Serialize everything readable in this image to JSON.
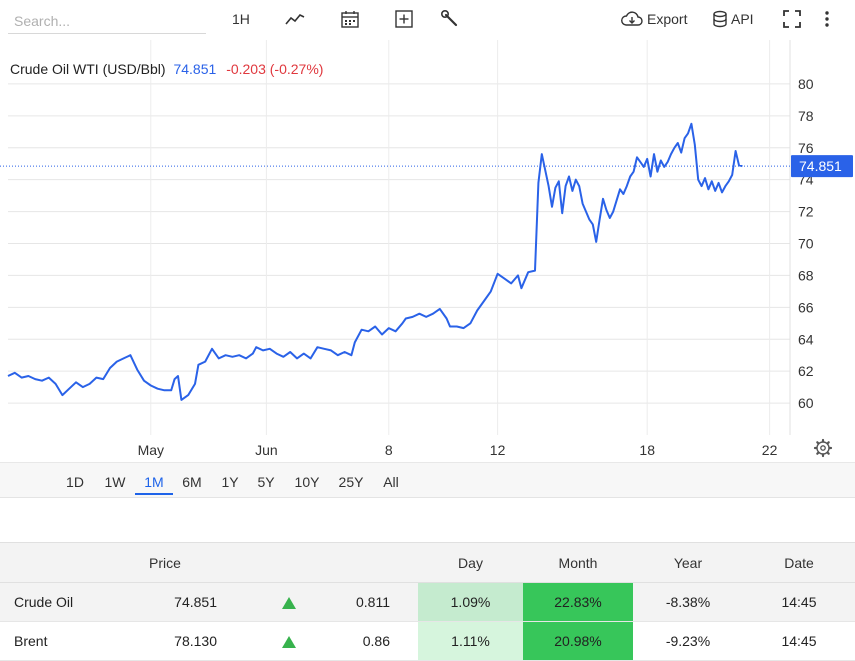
{
  "toolbar": {
    "search_placeholder": "Search...",
    "interval_label": "1H",
    "export_label": "Export",
    "api_label": "API",
    "icons": [
      "line-chart-icon",
      "calendar-icon",
      "plus-square-icon",
      "wrench-icon",
      "cloud-download-icon",
      "database-icon",
      "fullscreen-icon",
      "more-vertical-icon"
    ]
  },
  "quote": {
    "name": "Crude Oil WTI (USD/Bbl)",
    "price": "74.851",
    "change": "-0.203 (-0.27%)",
    "price_label": "74.851"
  },
  "colors": {
    "line": "#2a62e8",
    "negative": "#e0383e",
    "price_tag": "#2a62e8",
    "day_cell_1": "#c5ebcf",
    "day_cell_2": "#d6f5dd",
    "month_cell": "#37c65a"
  },
  "chart_data": {
    "type": "line",
    "series": [
      {
        "name": "Crude Oil WTI (USD/Bbl)",
        "values": [
          [
            0,
            61.7
          ],
          [
            2,
            61.9
          ],
          [
            4,
            61.6
          ],
          [
            6,
            61.7
          ],
          [
            8,
            61.5
          ],
          [
            10,
            61.4
          ],
          [
            12,
            61.6
          ],
          [
            14,
            61.2
          ],
          [
            16,
            60.5
          ],
          [
            18,
            60.9
          ],
          [
            20,
            61.3
          ],
          [
            22,
            61.0
          ],
          [
            24,
            61.2
          ],
          [
            26,
            61.6
          ],
          [
            28,
            61.5
          ],
          [
            30,
            62.2
          ],
          [
            32,
            62.6
          ],
          [
            34,
            62.8
          ],
          [
            36,
            63.0
          ],
          [
            38,
            62.1
          ],
          [
            40,
            61.4
          ],
          [
            42,
            61.1
          ],
          [
            44,
            60.9
          ],
          [
            46,
            60.8
          ],
          [
            48,
            60.8
          ],
          [
            49,
            61.5
          ],
          [
            50,
            61.7
          ],
          [
            51,
            60.2
          ],
          [
            53,
            60.5
          ],
          [
            55,
            61.2
          ],
          [
            56,
            62.4
          ],
          [
            58,
            62.6
          ],
          [
            60,
            63.4
          ],
          [
            62,
            62.8
          ],
          [
            64,
            63.0
          ],
          [
            66,
            62.9
          ],
          [
            68,
            63.0
          ],
          [
            70,
            62.8
          ],
          [
            72,
            63.1
          ],
          [
            73,
            63.5
          ],
          [
            75,
            63.3
          ],
          [
            77,
            63.4
          ],
          [
            79,
            63.1
          ],
          [
            81,
            62.9
          ],
          [
            83,
            63.2
          ],
          [
            85,
            62.8
          ],
          [
            87,
            63.1
          ],
          [
            89,
            62.8
          ],
          [
            91,
            63.5
          ],
          [
            93,
            63.4
          ],
          [
            95,
            63.3
          ],
          [
            97,
            63.0
          ],
          [
            99,
            63.2
          ],
          [
            101,
            63.0
          ],
          [
            102,
            63.8
          ],
          [
            104,
            64.6
          ],
          [
            106,
            64.5
          ],
          [
            108,
            64.8
          ],
          [
            110,
            64.3
          ],
          [
            112,
            64.7
          ],
          [
            114,
            64.5
          ],
          [
            116,
            65.0
          ],
          [
            117,
            65.3
          ],
          [
            119,
            65.4
          ],
          [
            121,
            65.6
          ],
          [
            123,
            65.4
          ],
          [
            125,
            65.6
          ],
          [
            127,
            65.9
          ],
          [
            129,
            65.3
          ],
          [
            130,
            64.8
          ],
          [
            132,
            64.8
          ],
          [
            134,
            64.7
          ],
          [
            136,
            65.0
          ],
          [
            138,
            65.8
          ],
          [
            140,
            66.4
          ],
          [
            142,
            67.0
          ],
          [
            144,
            68.1
          ],
          [
            146,
            67.8
          ],
          [
            148,
            67.5
          ],
          [
            150,
            68.0
          ],
          [
            151,
            67.2
          ],
          [
            153,
            68.2
          ],
          [
            155,
            68.3
          ],
          [
            156,
            73.8
          ],
          [
            157,
            75.6
          ],
          [
            158,
            74.6
          ],
          [
            159,
            73.6
          ],
          [
            160,
            72.3
          ],
          [
            161,
            73.5
          ],
          [
            162,
            73.9
          ],
          [
            163,
            71.9
          ],
          [
            164,
            73.6
          ],
          [
            165,
            74.2
          ],
          [
            166,
            73.3
          ],
          [
            167,
            74.0
          ],
          [
            168,
            73.6
          ],
          [
            169,
            72.5
          ],
          [
            170,
            72.0
          ],
          [
            171,
            71.5
          ],
          [
            172,
            71.2
          ],
          [
            173,
            70.1
          ],
          [
            174,
            71.5
          ],
          [
            175,
            72.8
          ],
          [
            176,
            72.1
          ],
          [
            177,
            71.6
          ],
          [
            178,
            72.0
          ],
          [
            179,
            72.7
          ],
          [
            180,
            73.4
          ],
          [
            181,
            73.1
          ],
          [
            182,
            73.6
          ],
          [
            183,
            74.2
          ],
          [
            184,
            74.5
          ],
          [
            185,
            75.4
          ],
          [
            186,
            75.1
          ],
          [
            187,
            74.8
          ],
          [
            188,
            75.3
          ],
          [
            189,
            74.2
          ],
          [
            190,
            75.6
          ],
          [
            191,
            74.5
          ],
          [
            192,
            75.2
          ],
          [
            193,
            74.8
          ],
          [
            194,
            75.1
          ],
          [
            195,
            75.6
          ],
          [
            196,
            76.0
          ],
          [
            197,
            76.3
          ],
          [
            198,
            75.7
          ],
          [
            199,
            76.6
          ],
          [
            200,
            76.9
          ],
          [
            201,
            77.5
          ],
          [
            202,
            76.2
          ],
          [
            203,
            74.0
          ],
          [
            204,
            73.6
          ],
          [
            205,
            74.1
          ],
          [
            206,
            73.4
          ],
          [
            207,
            73.9
          ],
          [
            208,
            73.3
          ],
          [
            209,
            73.8
          ],
          [
            210,
            73.2
          ],
          [
            211,
            73.6
          ],
          [
            212,
            73.9
          ],
          [
            213,
            74.3
          ],
          [
            214,
            75.8
          ],
          [
            215,
            74.9
          ],
          [
            216,
            74.851
          ]
        ]
      }
    ],
    "x_tick_labels": [
      {
        "label": "May",
        "x": 42
      },
      {
        "label": "Jun",
        "x": 76
      },
      {
        "label": "8",
        "x": 112
      },
      {
        "label": "12",
        "x": 144
      },
      {
        "label": "18",
        "x": 188
      },
      {
        "label": "22",
        "x": 224
      }
    ],
    "xlim": [
      0,
      230
    ],
    "yticks": [
      60,
      62,
      64,
      66,
      68,
      70,
      72,
      74,
      76,
      78,
      80
    ],
    "ylim": [
      58,
      81.5
    ],
    "current_value": 74.851,
    "grid": true,
    "y_axis_position": "right",
    "title": "Crude Oil WTI (USD/Bbl)",
    "xlabel": "",
    "ylabel": ""
  },
  "ranges": [
    "1D",
    "1W",
    "1M",
    "6M",
    "1Y",
    "5Y",
    "10Y",
    "25Y",
    "All"
  ],
  "active_range": "1M",
  "table": {
    "headers": [
      "",
      "Price",
      "",
      "",
      "Day",
      "Month",
      "Year",
      "Date"
    ],
    "rows": [
      {
        "name": "Crude Oil",
        "price": "74.851",
        "change": "0.811",
        "day": "1.09%",
        "month": "22.83%",
        "year": "-8.38%",
        "date": "14:45"
      },
      {
        "name": "Brent",
        "price": "78.130",
        "change": "0.86",
        "day": "1.11%",
        "month": "20.98%",
        "year": "-9.23%",
        "date": "14:45"
      }
    ]
  }
}
